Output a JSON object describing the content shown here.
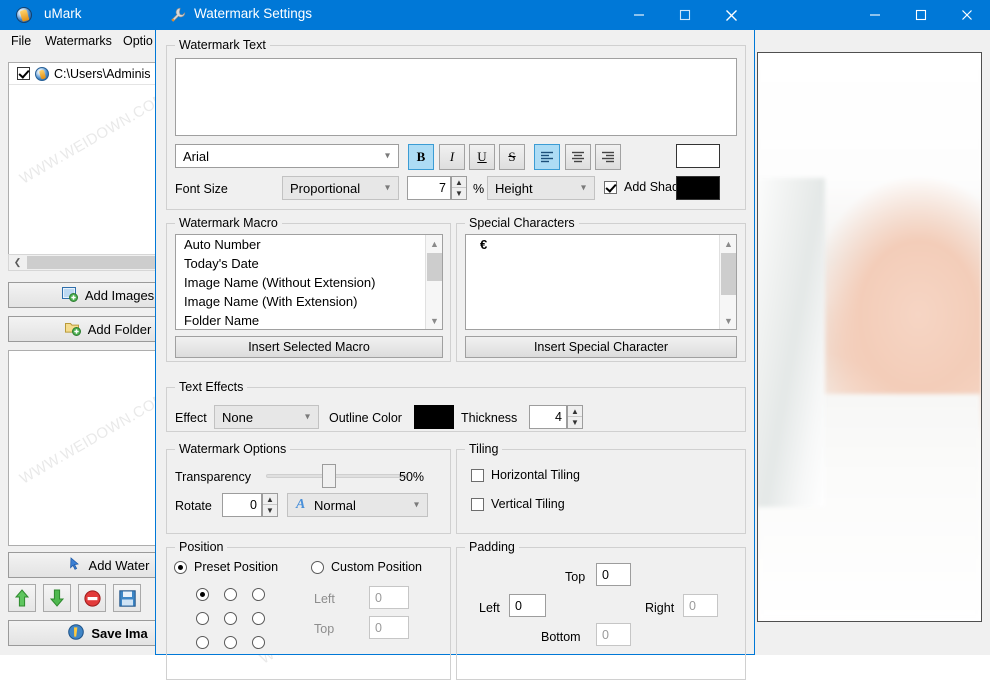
{
  "background_window": {
    "title": "uMark",
    "app_icon": "umark-app-icon",
    "menu": [
      "File",
      "Watermarks",
      "Optio"
    ],
    "file_list": [
      {
        "checked": true,
        "path": "C:\\Users\\Adminis"
      }
    ],
    "buttons": {
      "add_images": "Add Images",
      "add_folder": "Add Folder",
      "add_watermark": "Add Water",
      "save_images": "Save Ima"
    },
    "toolbar_icons": [
      "move-up-icon",
      "move-down-icon",
      "remove-icon",
      "save-icon"
    ],
    "window_controls": {
      "minimize": "–",
      "maximize": "□",
      "close": "✕"
    }
  },
  "watermark_overlay": {
    "text": "WWW.WEIDOWN.COM"
  },
  "dialog": {
    "title": "Watermark Settings",
    "icon": "wrench-icon",
    "window_controls": {
      "minimize": "–",
      "maximize": "□",
      "close": "✕"
    },
    "watermark_text": {
      "legend": "Watermark Text",
      "value": "",
      "font_family": "Arial",
      "style_buttons": [
        {
          "name": "bold",
          "label": "B",
          "active": true
        },
        {
          "name": "italic",
          "label": "I",
          "active": false
        },
        {
          "name": "underline",
          "label": "U",
          "active": false
        },
        {
          "name": "strikethrough",
          "label": "S",
          "active": false
        }
      ],
      "align_buttons": [
        {
          "name": "align-left",
          "active": true
        },
        {
          "name": "align-center",
          "active": false
        },
        {
          "name": "align-right",
          "active": false
        }
      ],
      "text_color": "#ffffff",
      "shadow_color": "#000000",
      "font_size_label": "Font Size",
      "font_size_mode": "Proportional",
      "font_size_value": "7",
      "percent_label": "%",
      "font_size_basis": "Height",
      "add_shadow_label": "Add Shadow",
      "add_shadow_checked": true
    },
    "watermark_macro": {
      "legend": "Watermark Macro",
      "items": [
        "Auto Number",
        "Today's Date",
        "Image Name (Without Extension)",
        "Image Name (With Extension)",
        "Folder Name"
      ],
      "insert_button": "Insert Selected Macro"
    },
    "special_characters": {
      "legend": "Special Characters",
      "items": [
        "€"
      ],
      "insert_button": "Insert Special Character"
    },
    "text_effects": {
      "legend": "Text Effects",
      "effect_label": "Effect",
      "effect_value": "None",
      "outline_color_label": "Outline Color",
      "outline_color": "#000000",
      "thickness_label": "Thickness",
      "thickness_value": "4"
    },
    "watermark_options": {
      "legend": "Watermark Options",
      "transparency_label": "Transparency",
      "transparency_value": "50%",
      "transparency_percent": 50,
      "rotate_label": "Rotate",
      "rotate_value": "0",
      "style_value": "Normal",
      "style_icon": "italic-a-icon"
    },
    "tiling": {
      "legend": "Tiling",
      "horizontal_label": "Horizontal Tiling",
      "horizontal_checked": false,
      "vertical_label": "Vertical Tiling",
      "vertical_checked": false
    },
    "position": {
      "legend": "Position",
      "preset_label": "Preset Position",
      "preset_selected": true,
      "custom_label": "Custom Position",
      "custom_selected": false,
      "grid_selected_index": 0,
      "left_label": "Left",
      "left_value": "0",
      "top_label": "Top",
      "top_value": "0"
    },
    "padding": {
      "legend": "Padding",
      "top_label": "Top",
      "top_value": "0",
      "left_label": "Left",
      "left_value": "0",
      "right_label": "Right",
      "right_value": "0",
      "bottom_label": "Bottom",
      "bottom_value": "0"
    }
  }
}
